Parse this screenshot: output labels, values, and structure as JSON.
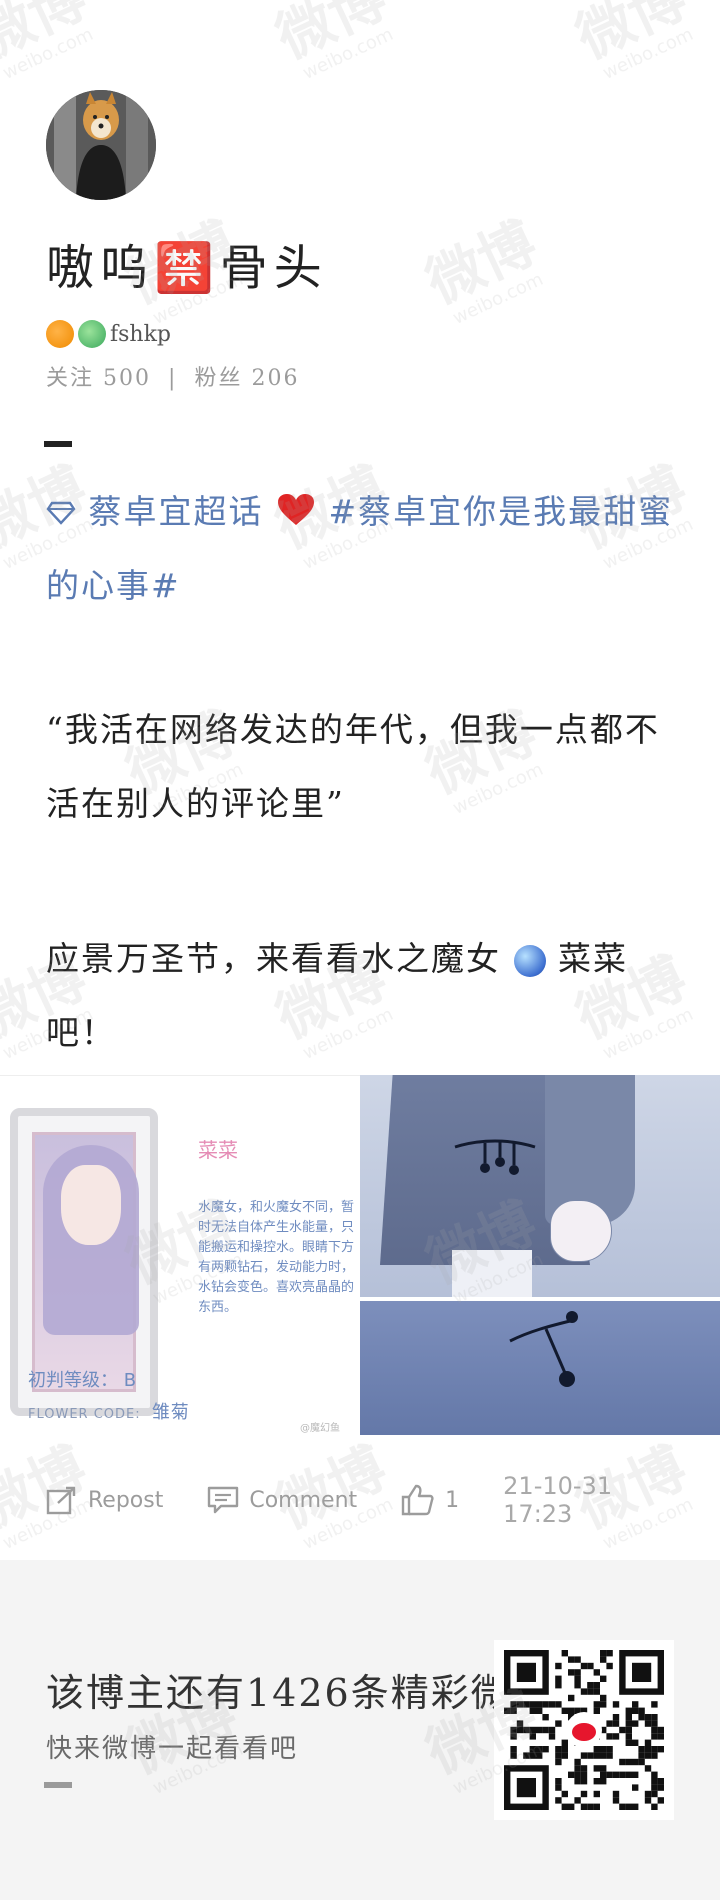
{
  "profile": {
    "display_name": "嗷呜🈲骨头",
    "handle": "fshkp",
    "stats": {
      "following_label": "关注",
      "following": "500",
      "separator": "|",
      "followers_label": "粉丝",
      "followers": "206"
    }
  },
  "post": {
    "tags": {
      "topic": "蔡卓宜超话",
      "hashtag_line1": "#蔡卓宜你是我最甜蜜",
      "hashtag_line2": "的心事#"
    },
    "paragraph1": "“我活在网络发达的年代，但我一点都不活在别人的评论里”",
    "paragraph2_a": "应景万圣节，来看看水之魔女",
    "paragraph2_b": "菜菜吧！"
  },
  "image_card": {
    "name": "菜菜",
    "description": "水魔女，和火魔女不同，暂时无法自体产生水能量，只能搬运和操控水。眼睛下方有两颗钻石，发动能力时，水钻会变色。喜欢亮晶晶的东西。",
    "rank_label": "初判等级：",
    "rank_value": "B",
    "flower_code_label": "FLOWER CODE:",
    "flower_code_value": "雏菊",
    "watermark": "@魔幻鱼"
  },
  "actions": {
    "repost": "Repost",
    "comment": "Comment",
    "likes": "1",
    "timestamp": "21-10-31 17:23"
  },
  "promo": {
    "title": "该博主还有1426条精彩微博",
    "subtitle": "快来微博一起看看吧"
  },
  "watermark": {
    "text": "微博",
    "domain": "weibo.com"
  },
  "colors": {
    "link": "#5a7bb3",
    "heart": "#e02424",
    "muted": "#9c9c9c"
  }
}
